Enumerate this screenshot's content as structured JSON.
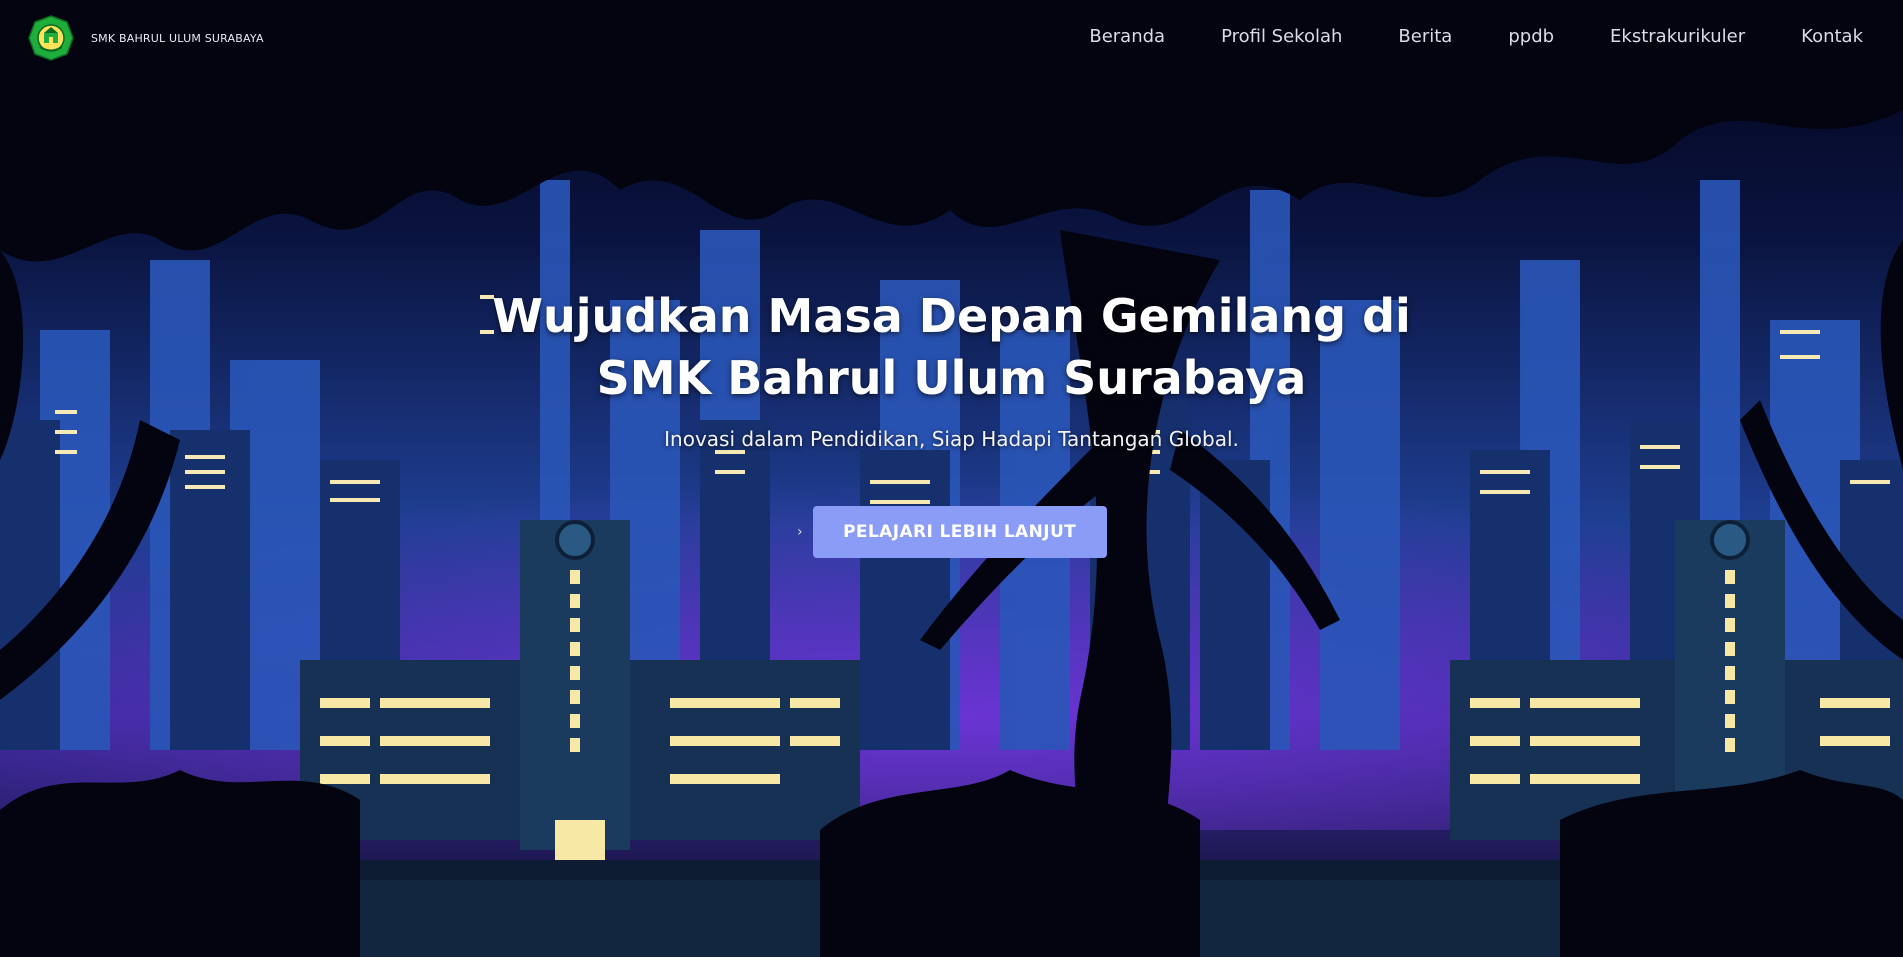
{
  "brand": {
    "name": "SMK BAHRUL ULUM SURABAYA",
    "logo_icon": "school-emblem-icon"
  },
  "nav": {
    "items": [
      {
        "label": "Beranda"
      },
      {
        "label": "Profil Sekolah"
      },
      {
        "label": "Berita"
      },
      {
        "label": "ppdb"
      },
      {
        "label": "Ekstrakurikuler"
      },
      {
        "label": "Kontak"
      }
    ]
  },
  "hero": {
    "title_line1": "Wujudkan Masa Depan Gemilang di",
    "title_line2": "SMK Bahrul Ulum Surabaya",
    "tagline": "Inovasi dalam Pendidikan, Siap Hadapi Tantangan Global.",
    "cta_label": "PELAJARI LEBIH LANJUT",
    "cta_icon": "chevron-right-icon"
  },
  "colors": {
    "sky_top": "#03041a",
    "sky_mid": "#1d3a8a",
    "glow_purple": "#6a2fd0",
    "window_light": "#fbf1c2",
    "cta_bg": "#8a9cf5",
    "logo_green": "#1fae3c"
  }
}
